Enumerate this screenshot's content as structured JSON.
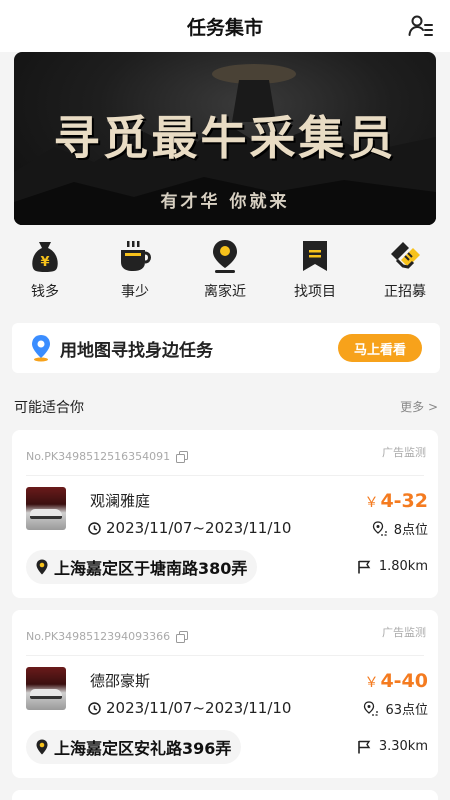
{
  "header": {
    "title": "任务集市"
  },
  "banner": {
    "slogan": "寻觅最牛采集员",
    "sub": "有才华 你就来"
  },
  "categories": [
    {
      "label": "钱多",
      "icon": "money-bag-icon"
    },
    {
      "label": "事少",
      "icon": "coffee-cup-icon"
    },
    {
      "label": "离家近",
      "icon": "location-pin-icon"
    },
    {
      "label": "找项目",
      "icon": "bookmark-icon"
    },
    {
      "label": "正招募",
      "icon": "handshake-icon"
    }
  ],
  "mapbar": {
    "text": "用地图寻找身边任务",
    "button": "马上看看"
  },
  "section": {
    "title": "可能适合你",
    "more": "更多 >"
  },
  "tasks": [
    {
      "no": "No.PK3498512516354091",
      "ad": "广告监测",
      "name": "观澜雅庭",
      "date": "2023/11/07~2023/11/10",
      "currency": "￥",
      "price": "4-32",
      "spots": "8点位",
      "address": "上海嘉定区于塘南路380弄",
      "distance": "1.80km"
    },
    {
      "no": "No.PK3498512394093366",
      "ad": "广告监测",
      "name": "德邵豪斯",
      "date": "2023/11/07~2023/11/10",
      "currency": "￥",
      "price": "4-40",
      "spots": "63点位",
      "address": "上海嘉定区安礼路396弄",
      "distance": "3.30km"
    }
  ],
  "colors": {
    "accent": "#f7a21b",
    "price": "#f47b20",
    "icon": "#222222"
  }
}
